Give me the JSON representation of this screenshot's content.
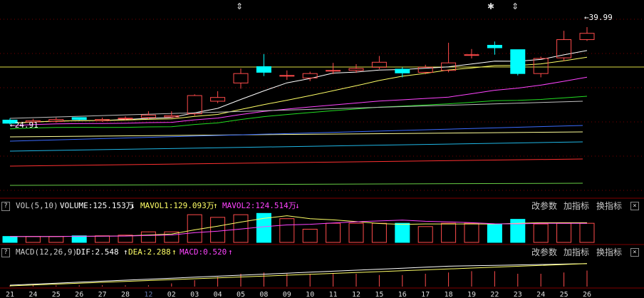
{
  "colors": {
    "up": "#ff4b4b",
    "down": "#00ffff",
    "ma5": "#ffffff",
    "ma10": "#ffff66",
    "ma20": "#ff44ff",
    "ma30": "#22dd22",
    "ma60": "#c0c0c0",
    "ma120": "#3b6cff",
    "ma250": "#ffff99",
    "ma_x1": "#1fb7e6",
    "ma_x2": "#ff3030",
    "ma_x3": "#66cc44",
    "baseline": "#dddd44",
    "grid": "#7a0000",
    "vol_label": "#cccccc",
    "volume_val": "#ffffff",
    "mavol1": "#ffff66",
    "mavol2": "#ff44ff",
    "dif": "#ffffff",
    "dea": "#ffff66",
    "macd": "#ff44ff"
  },
  "price_chart": {
    "max_label": "39.99",
    "min_label": "24.91",
    "markers": [
      "⇕",
      "✱",
      "⇕"
    ]
  },
  "volume_panel": {
    "question": "?",
    "label": "VOL(5,10)",
    "volume": "VOLUME:125.153万",
    "volume_arrow": "↓",
    "mavol1": "MAVOL1:129.093万",
    "mavol1_arrow": "↑",
    "mavol2": "MAVOL2:124.514万",
    "mavol2_arrow": "↓",
    "btn_params": "改参数",
    "btn_add": "加指标",
    "btn_switch": "换指标",
    "close": "×"
  },
  "macd_panel": {
    "question": "?",
    "label": "MACD(12,26,9)",
    "dif": "DIF:2.548",
    "dif_arrow": "↑",
    "dea": "DEA:2.288",
    "dea_arrow": "↑",
    "macd": "MACD:0.520",
    "macd_arrow": "↑",
    "btn_params": "改参数",
    "btn_add": "加指标",
    "btn_switch": "换指标",
    "close": "×"
  },
  "date_axis": {
    "labels": [
      "21",
      "24",
      "25",
      "26",
      "27",
      "28",
      "12",
      "02",
      "03",
      "04",
      "05",
      "08",
      "09",
      "10",
      "11",
      "12",
      "15",
      "16",
      "17",
      "18",
      "19",
      "22",
      "23",
      "24",
      "25",
      "26"
    ],
    "highlight_index": 6
  },
  "chart_data": {
    "type": "candlestick",
    "price_range": [
      24.91,
      39.99
    ],
    "candles": [
      {
        "o": 25.2,
        "c": 24.7,
        "h": 25.5,
        "l": 24.5
      },
      {
        "o": 24.9,
        "c": 25.1,
        "h": 25.4,
        "l": 24.7
      },
      {
        "o": 25.0,
        "c": 25.3,
        "h": 25.6,
        "l": 24.8
      },
      {
        "o": 25.6,
        "c": 25.3,
        "h": 25.6,
        "l": 25.2
      },
      {
        "o": 25.1,
        "c": 25.3,
        "h": 25.6,
        "l": 24.9
      },
      {
        "o": 25.4,
        "c": 25.5,
        "h": 25.8,
        "l": 25.2
      },
      {
        "o": 25.6,
        "c": 26.0,
        "h": 26.6,
        "l": 25.4
      },
      {
        "o": 25.7,
        "c": 25.9,
        "h": 26.6,
        "l": 25.5
      },
      {
        "o": 26.2,
        "c": 29.1,
        "h": 29.3,
        "l": 25.9
      },
      {
        "o": 28.2,
        "c": 28.8,
        "h": 29.8,
        "l": 27.9
      },
      {
        "o": 31.1,
        "c": 32.6,
        "h": 33.4,
        "l": 30.2
      },
      {
        "o": 33.7,
        "c": 32.8,
        "h": 35.7,
        "l": 32.2
      },
      {
        "o": 32.3,
        "c": 32.3,
        "h": 33.1,
        "l": 31.6
      },
      {
        "o": 31.9,
        "c": 32.6,
        "h": 32.9,
        "l": 31.4
      },
      {
        "o": 33.0,
        "c": 33.1,
        "h": 34.3,
        "l": 32.5
      },
      {
        "o": 33.1,
        "c": 33.4,
        "h": 34.1,
        "l": 32.7
      },
      {
        "o": 33.6,
        "c": 34.4,
        "h": 35.4,
        "l": 33.3
      },
      {
        "o": 33.3,
        "c": 32.7,
        "h": 33.6,
        "l": 32.0
      },
      {
        "o": 32.8,
        "c": 33.6,
        "h": 34.0,
        "l": 32.5
      },
      {
        "o": 33.1,
        "c": 34.3,
        "h": 37.5,
        "l": 32.8
      },
      {
        "o": 35.5,
        "c": 35.6,
        "h": 36.5,
        "l": 35.0
      },
      {
        "o": 37.1,
        "c": 36.7,
        "h": 37.7,
        "l": 35.6
      },
      {
        "o": 36.4,
        "c": 32.6,
        "h": 36.4,
        "l": 32.3
      },
      {
        "o": 32.6,
        "c": 35.0,
        "h": 35.3,
        "l": 32.0
      },
      {
        "o": 35.1,
        "c": 38.0,
        "h": 39.4,
        "l": 34.6
      },
      {
        "o": 38.0,
        "c": 39.0,
        "h": 39.99,
        "l": 37.8
      }
    ],
    "volumes": [
      0.45,
      0.45,
      0.45,
      0.5,
      0.5,
      0.55,
      0.8,
      0.8,
      2.1,
      1.9,
      2.1,
      2.2,
      1.8,
      1.0,
      1.45,
      1.45,
      1.45,
      1.45,
      1.2,
      1.45,
      1.45,
      1.4,
      1.75,
      1.4,
      1.45,
      1.45
    ],
    "macd_bars": [
      0.02,
      0.02,
      0.02,
      0.02,
      0.02,
      0.02,
      0.02,
      0.05,
      0.1,
      0.15,
      0.2,
      0.22,
      0.2,
      0.2,
      0.21,
      0.2,
      0.18,
      0.18,
      0.2,
      0.22,
      0.24,
      0.24,
      0.2,
      0.2,
      0.22,
      0.25
    ]
  }
}
